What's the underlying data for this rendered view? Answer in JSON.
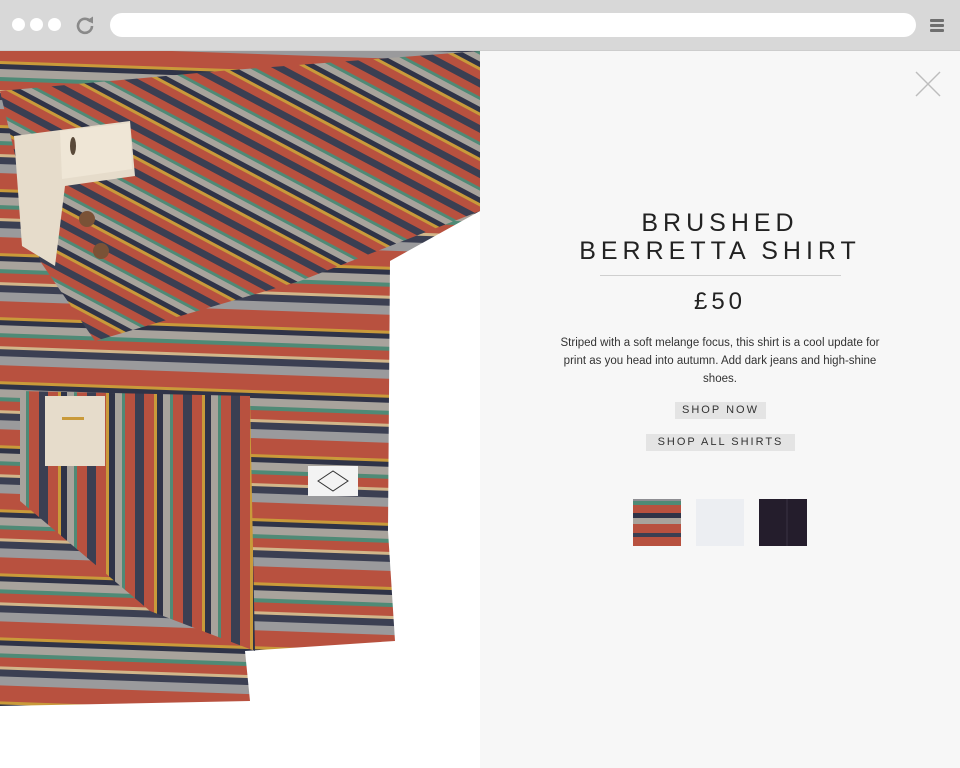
{
  "browser": {
    "controls": [
      "close-dot",
      "minimize-dot",
      "maximize-dot"
    ],
    "reload_icon": "reload-icon",
    "menu_icon": "hamburger-menu-icon",
    "url": ""
  },
  "product": {
    "image_alt_icon": "striped-shirt-photo",
    "title_line1": "BRUSHED",
    "title_line2": "BERRETTA SHIRT",
    "price": "£50",
    "description": "Striped with a soft melange focus, this shirt is a cool update for print as you head into autumn. Add dark jeans and high-shine shoes.",
    "shop_now_label": "SHOP NOW",
    "shop_all_label": "SHOP ALL SHIRTS",
    "close_icon": "close-icon",
    "swatches": [
      {
        "name": "striped",
        "color": "#b14f3e"
      },
      {
        "name": "light-grey",
        "color": "#eceef2"
      },
      {
        "name": "navy",
        "color": "#241d2c"
      }
    ]
  },
  "colors": {
    "chrome": "#d8d8d8",
    "panel_bg": "#f7f7f7",
    "stripe_red": "#b8513f",
    "stripe_navy": "#2f3347",
    "stripe_grey": "#8a8a8e",
    "stripe_green": "#4f8a76",
    "stripe_mustard": "#c99a3a"
  }
}
